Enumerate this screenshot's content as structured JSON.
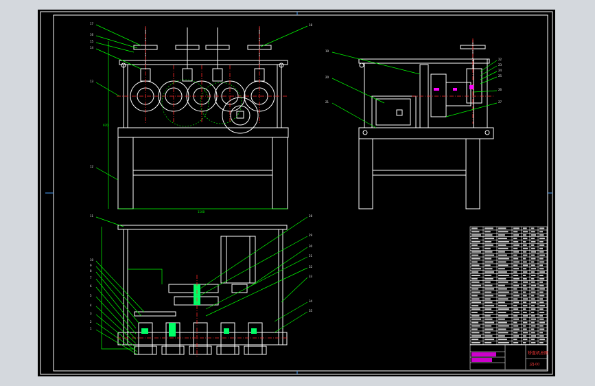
{
  "drawing": {
    "callouts_front": [
      "17",
      "16",
      "15",
      "14",
      "13",
      "12",
      "18"
    ],
    "callouts_side": [
      "19",
      "20",
      "21",
      "22",
      "23",
      "24",
      "25",
      "26",
      "27"
    ],
    "callouts_top": [
      "11",
      "10",
      "9",
      "8",
      "7",
      "6",
      "5",
      "4",
      "3",
      "2",
      "1",
      "28",
      "29",
      "30",
      "31",
      "32",
      "33",
      "34",
      "35"
    ],
    "dim_width": "1100",
    "dim_height": "970"
  },
  "title_block": {
    "title": "矫直机总图",
    "drawing_no": "JZJ-00"
  },
  "colors": {
    "paper": "#000000",
    "outline": "#ffffff",
    "leader": "#00ff00",
    "centerline": "#ff2a2a",
    "highlight": "#00ff66",
    "accent": "#ff00ff"
  }
}
